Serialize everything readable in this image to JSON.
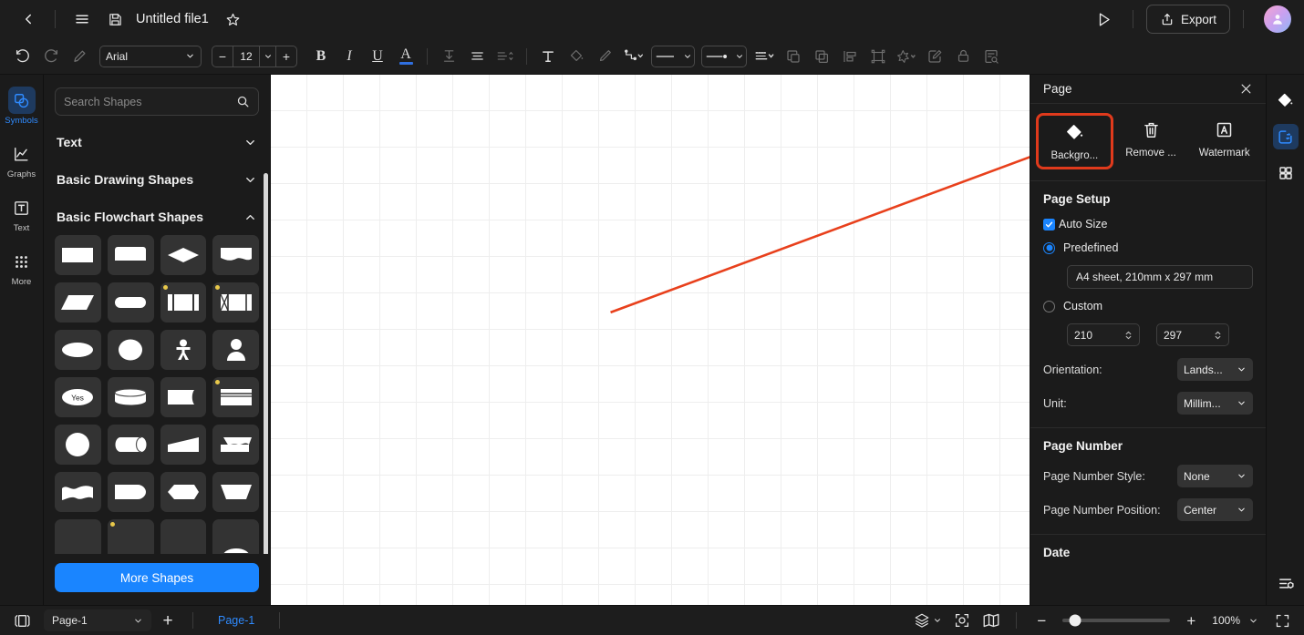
{
  "titlebar": {
    "back_icon": "chevron-left-icon",
    "menu_icon": "hamburger-menu-icon",
    "save_icon": "save-disk-icon",
    "doc_title": "Untitled file1",
    "favorite_icon": "star-icon",
    "present_icon": "play-present-icon",
    "export_label": "Export",
    "export_icon": "upload-share-icon",
    "avatar_icon": "user-avatar"
  },
  "toolbar": {
    "undo_icon": "undo-icon",
    "redo_icon": "redo-icon",
    "format_painter_icon": "format-painter-icon",
    "font_family": "Arial",
    "font_size": "12",
    "decrease_label": "−",
    "increase_label": "+",
    "bold_label": "B",
    "italic_label": "I",
    "underline_label": "U",
    "font_color_label": "A",
    "items": [
      {
        "icon": "text-vertical-align-icon",
        "dim": true
      },
      {
        "icon": "text-align-icon",
        "dim": false
      },
      {
        "icon": "line-spacing-icon",
        "dim": true
      },
      {
        "icon": "insert-text-box-icon",
        "dim": false
      },
      {
        "icon": "fill-color-icon",
        "dim": true
      },
      {
        "icon": "line-color-brush-icon",
        "dim": true
      },
      {
        "icon": "connector-type-icon",
        "dim": false
      },
      {
        "icon": "line-style-icon",
        "dim": false
      },
      {
        "icon": "arrow-end-style-icon",
        "dim": false
      },
      {
        "icon": "line-weight-icon",
        "dim": false
      },
      {
        "icon": "bring-to-front-icon",
        "dim": true
      },
      {
        "icon": "send-to-back-icon",
        "dim": true
      },
      {
        "icon": "align-objects-icon",
        "dim": true
      },
      {
        "icon": "group-objects-icon",
        "dim": true
      },
      {
        "icon": "effects-icon",
        "dim": true
      },
      {
        "icon": "edit-shape-icon",
        "dim": true
      },
      {
        "icon": "lock-icon",
        "dim": true
      },
      {
        "icon": "find-replace-icon",
        "dim": true
      }
    ]
  },
  "left_rail": {
    "items": [
      {
        "label": "Symbols",
        "icon": "symbols-shapes-icon",
        "active": true
      },
      {
        "label": "Graphs",
        "icon": "graphs-chart-icon",
        "active": false
      },
      {
        "label": "Text",
        "icon": "text-box-icon",
        "active": false
      },
      {
        "label": "More",
        "icon": "more-grid-dots-icon",
        "active": false
      }
    ]
  },
  "shapes_panel": {
    "search_placeholder": "Search Shapes",
    "search_value": "",
    "search_icon": "search-icon",
    "sections": [
      {
        "title": "Text",
        "expanded": false
      },
      {
        "title": "Basic Drawing Shapes",
        "expanded": false
      },
      {
        "title": "Basic Flowchart Shapes",
        "expanded": true
      }
    ],
    "more_shapes_label": "More Shapes",
    "shape_cells": [
      {
        "name": "process-rectangle",
        "dot": false
      },
      {
        "name": "rectangle-rounded-top",
        "dot": false
      },
      {
        "name": "decision-diamond",
        "dot": false
      },
      {
        "name": "document-wave-bottom",
        "dot": false
      },
      {
        "name": "data-parallelogram",
        "dot": false
      },
      {
        "name": "terminator-stadium",
        "dot": false
      },
      {
        "name": "predefined-process",
        "dot": true
      },
      {
        "name": "internal-storage",
        "dot": true
      },
      {
        "name": "ellipse-flat",
        "dot": false
      },
      {
        "name": "circle",
        "dot": false
      },
      {
        "name": "actor-person-stick",
        "dot": false
      },
      {
        "name": "actor-person-bust",
        "dot": false
      },
      {
        "name": "decision-yes-oval",
        "dot": false
      },
      {
        "name": "direct-data-cylinder-top",
        "dot": false
      },
      {
        "name": "delay-curved-right",
        "dot": false
      },
      {
        "name": "card-lined",
        "dot": true
      },
      {
        "name": "circle-large",
        "dot": false
      },
      {
        "name": "direct-access-storage",
        "dot": false
      },
      {
        "name": "trapezoid-slant",
        "dot": false
      },
      {
        "name": "manual-operation",
        "dot": false
      },
      {
        "name": "multi-document-wave",
        "dot": false
      },
      {
        "name": "stored-data-curved",
        "dot": false
      },
      {
        "name": "hexagon-flat",
        "dot": false
      },
      {
        "name": "trapezoid-down",
        "dot": false
      },
      {
        "name": "partial-shape-row-a",
        "dot": false
      },
      {
        "name": "partial-shape-row-b",
        "dot": true
      },
      {
        "name": "partial-shape-row-c",
        "dot": false
      },
      {
        "name": "partial-shape-row-d",
        "dot": false
      }
    ]
  },
  "canvas": {
    "annotation_arrow_color": "#e8401c",
    "annotation_arrow_from": "670,352",
    "annotation_arrow_to": "1175,163"
  },
  "right_panel": {
    "title": "Page",
    "close_icon": "close-x-icon",
    "actions": [
      {
        "label": "Backgro...",
        "icon": "paint-bucket-icon",
        "highlighted": true
      },
      {
        "label": "Remove ...",
        "icon": "trash-delete-icon",
        "highlighted": false
      },
      {
        "label": "Watermark",
        "icon": "watermark-letter-a-icon",
        "highlighted": false
      }
    ],
    "page_setup": {
      "title": "Page Setup",
      "auto_size_label": "Auto Size",
      "auto_size_checked": true,
      "predefined_label": "Predefined",
      "predefined_selected": true,
      "predefined_value": "A4 sheet, 210mm x 297 mm",
      "custom_label": "Custom",
      "custom_selected": false,
      "custom_width": "210",
      "custom_height": "297",
      "orientation_label": "Orientation:",
      "orientation_value": "Lands...",
      "unit_label": "Unit:",
      "unit_value": "Millim..."
    },
    "page_number": {
      "title": "Page Number",
      "style_label": "Page Number Style:",
      "style_value": "None",
      "position_label": "Page Number Position:",
      "position_value": "Center"
    },
    "date": {
      "title": "Date"
    }
  },
  "far_rail": {
    "items": [
      {
        "icon": "paint-bucket-fill-icon",
        "active": false
      },
      {
        "icon": "page-settings-panel-icon",
        "active": true
      },
      {
        "icon": "apps-grid-icon",
        "active": false
      }
    ],
    "bottom_icon": "preferences-sliders-icon"
  },
  "statusbar": {
    "panel_toggle_icon": "toggle-panels-icon",
    "page_select_value": "Page-1",
    "add_page_label": "+",
    "page_tab_label": "Page-1",
    "layers_icon": "layers-icon",
    "focus_icon": "focus-target-icon",
    "map_icon": "map-overview-icon",
    "zoom_out_label": "−",
    "zoom_in_label": "+",
    "zoom_level": "100%",
    "fullscreen_icon": "fullscreen-icon"
  },
  "colors": {
    "accent_blue": "#1a85ff",
    "annotation_red": "#e8401c",
    "panel_bg": "#1b1b1b",
    "cell_bg": "#333333"
  }
}
